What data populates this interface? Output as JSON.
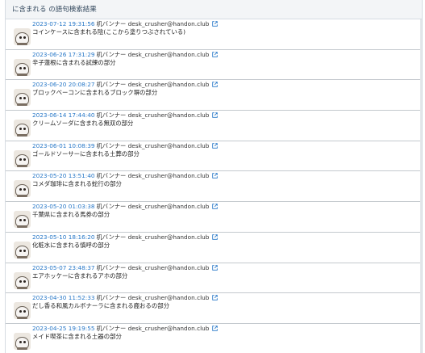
{
  "header": {
    "title": "に含まれる の語句検索結果"
  },
  "entries": [
    {
      "date": "2023-07-12 19:31:56",
      "author": "机バンナー desk_crusher@handon.club",
      "text": "コインケースに含まれる陰(ここから塗りつぶされている)"
    },
    {
      "date": "2023-06-26 17:31:29",
      "author": "机バンナー desk_crusher@handon.club",
      "text": "辛子蓮根に含まれる試練の部分"
    },
    {
      "date": "2023-06-20 20:08:27",
      "author": "机バンナー desk_crusher@handon.club",
      "text": "ブロックベーコンに含まれるブロック塀の部分"
    },
    {
      "date": "2023-06-14 17:44:40",
      "author": "机バンナー desk_crusher@handon.club",
      "text": "クリームソーダに含まれる無双の部分"
    },
    {
      "date": "2023-06-01 10:08:39",
      "author": "机バンナー desk_crusher@handon.club",
      "text": "ゴールドソーサーに含まれる土葬の部分"
    },
    {
      "date": "2023-05-20 13:51:40",
      "author": "机バンナー desk_crusher@handon.club",
      "text": "コメダ珈琲に含まれる蛇行の部分"
    },
    {
      "date": "2023-05-20 01:03:38",
      "author": "机バンナー desk_crusher@handon.club",
      "text": "千葉県に含まれる馬券の部分"
    },
    {
      "date": "2023-05-10 18:16:20",
      "author": "机バンナー desk_crusher@handon.club",
      "text": "化粧水に含まれる慎呼の部分"
    },
    {
      "date": "2023-05-07 23:48:37",
      "author": "机バンナー desk_crusher@handon.club",
      "text": "エアホッケーに含まれるアホの部分"
    },
    {
      "date": "2023-04-30 11:52:33",
      "author": "机バンナー desk_crusher@handon.club",
      "text": "だし香る和風カルボナーラに含まれる鹿おるの部分"
    },
    {
      "date": "2023-04-25 19:19:55",
      "author": "机バンナー desk_crusher@handon.club",
      "text": "メイド喫茶に含まれる土器の部分"
    }
  ]
}
